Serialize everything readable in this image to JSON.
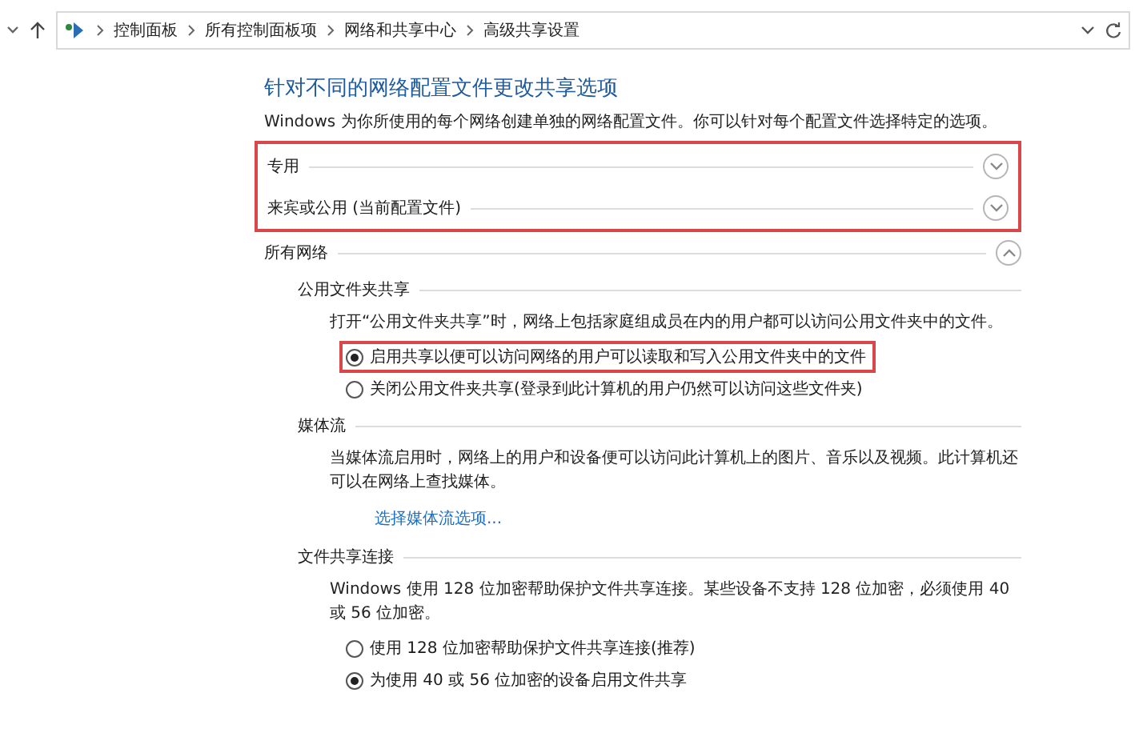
{
  "address_bar": {
    "path": [
      "控制面板",
      "所有控制面板项",
      "网络和共享中心",
      "高级共享设置"
    ]
  },
  "title": "针对不同的网络配置文件更改共享选项",
  "description": "Windows 为你所使用的每个网络创建单独的网络配置文件。你可以针对每个配置文件选择特定的选项。",
  "profiles": {
    "highlighted": true,
    "items": [
      {
        "label": "专用",
        "expanded": false
      },
      {
        "label": "来宾或公用 (当前配置文件)",
        "expanded": false
      }
    ]
  },
  "all_networks": {
    "label": "所有网络",
    "expanded": true
  },
  "sections": [
    {
      "heading": "公用文件夹共享",
      "description": "打开“公用文件夹共享”时，网络上包括家庭组成员在内的用户都可以访问公用文件夹中的文件。",
      "options": [
        {
          "label": "启用共享以便可以访问网络的用户可以读取和写入公用文件夹中的文件",
          "selected": true,
          "highlighted": true
        },
        {
          "label": "关闭公用文件夹共享(登录到此计算机的用户仍然可以访问这些文件夹)",
          "selected": false,
          "highlighted": false
        }
      ]
    },
    {
      "heading": "媒体流",
      "description": "当媒体流启用时，网络上的用户和设备便可以访问此计算机上的图片、音乐以及视频。此计算机还可以在网络上查找媒体。",
      "link": "选择媒体流选项..."
    },
    {
      "heading": "文件共享连接",
      "description": "Windows 使用 128 位加密帮助保护文件共享连接。某些设备不支持 128 位加密，必须使用 40 或 56 位加密。",
      "options": [
        {
          "label": "使用 128 位加密帮助保护文件共享连接(推荐)",
          "selected": false,
          "highlighted": false
        },
        {
          "label": "为使用 40 或 56 位加密的设备启用文件共享",
          "selected": true,
          "highlighted": false
        }
      ]
    }
  ]
}
